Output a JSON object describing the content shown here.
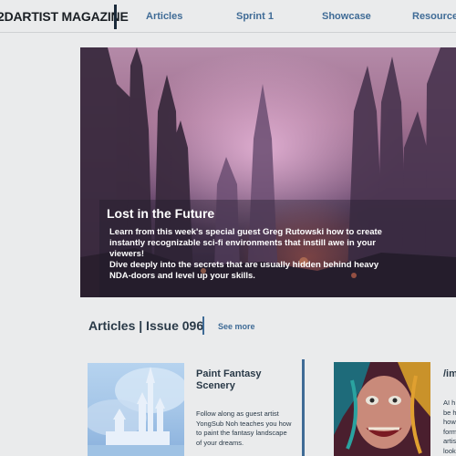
{
  "header": {
    "brand": "2DARTIST MAGAZINE",
    "nav": [
      "Articles",
      "Sprint 1",
      "Showcase",
      "Resources"
    ]
  },
  "hero": {
    "title": "Lost in the Future",
    "paragraphs": [
      "Learn from this week's special guest Greg Rutowski how to create instantly recognizable sci-fi environments that instill awe in your viewers!",
      "Dive deeply into the secrets that are usually hidden behind heavy NDA-doors and level up your skills."
    ]
  },
  "articles": {
    "heading": "Articles | Issue 096",
    "see_more": "See more",
    "cards": [
      {
        "title": "Paint Fantasy Scenery",
        "description": "Follow along as guest artist YongSub Noh teaches you how to paint the fantasy landscape of your dreams."
      },
      {
        "title": "/im",
        "description_lines": [
          "AI h",
          "be h",
          "how",
          "form",
          "artis",
          "look"
        ]
      }
    ]
  },
  "colors": {
    "background": "#eaebec",
    "accent": "#3f6b96",
    "heading": "#2a3a48"
  }
}
